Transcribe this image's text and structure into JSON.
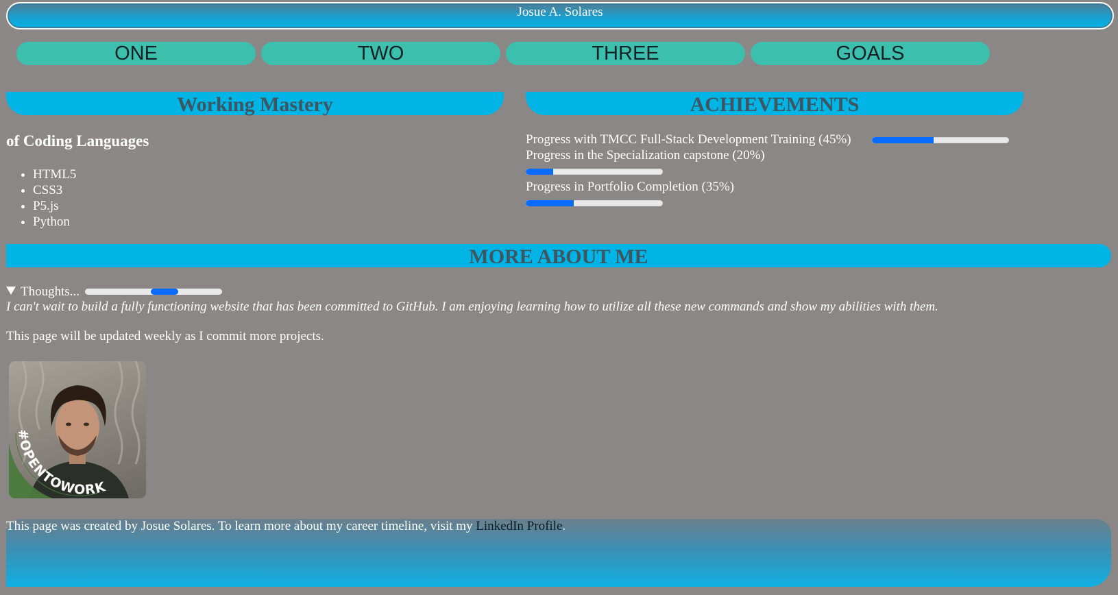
{
  "header": {
    "title": "Josue A. Solares"
  },
  "nav": {
    "items": [
      "ONE",
      "TWO",
      "THREE",
      "GOALS"
    ]
  },
  "mastery": {
    "banner": "Working Mastery",
    "subtitle": "of Coding Languages",
    "languages": [
      "HTML5",
      "CSS3",
      "P5.js",
      "Python"
    ]
  },
  "achievements": {
    "banner": "ACHIEVEMENTS",
    "items": [
      {
        "label": "Progress with TMCC Full-Stack Development Training (45%)",
        "progress": 0.45
      },
      {
        "label": "Progress in the Specialization capstone (20%)",
        "progress": 0.2
      },
      {
        "label": "Progress in Portfolio Completion (35%)",
        "progress": 0.35
      }
    ]
  },
  "more": {
    "banner": "MORE ABOUT ME",
    "summary": "Thoughts...",
    "thought": "I can't wait to build a fully functioning website that has been committed to GitHub. I am enjoying learning how to utilize all these new commands and show my abilities with them.",
    "update": "This page will be updated weekly as I commit more projects.",
    "avatar_badge": "#OPENTOWORK"
  },
  "footer": {
    "text_before": "This page was created by Josue Solares. To learn more about my career timeline, visit my ",
    "link": "LinkedIn Profile",
    "text_after": "."
  },
  "colors": {
    "background": "#8b8786",
    "banner": "#00b5e6",
    "nav": "#3dbfae",
    "progress_fill": "#0a6cff",
    "badge_green": "#4a7a3c"
  }
}
